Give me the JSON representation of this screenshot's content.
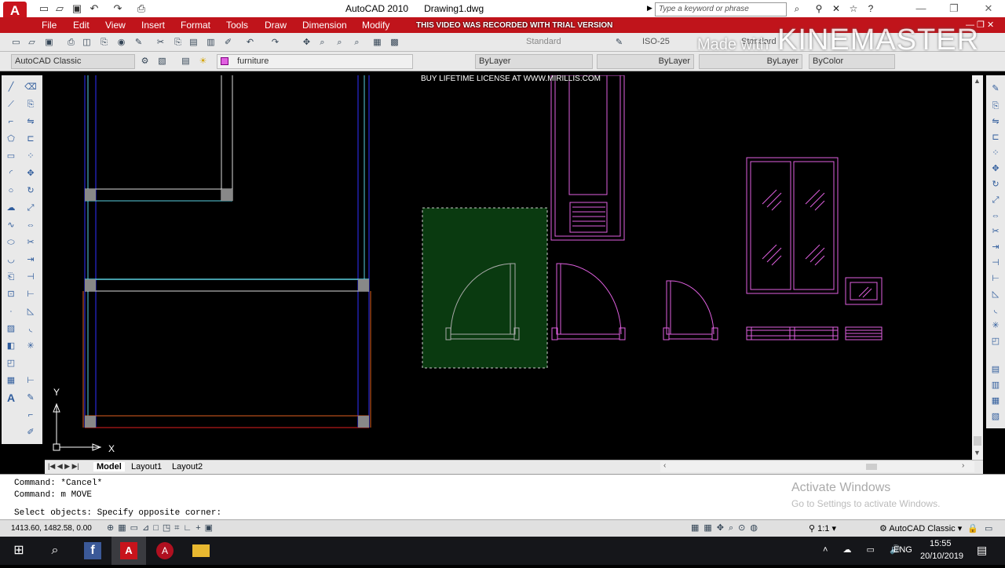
{
  "app": {
    "title": "AutoCAD 2010",
    "document": "Drawing1.dwg",
    "search_placeholder": "Type a keyword or phrase"
  },
  "menu": [
    "File",
    "Edit",
    "View",
    "Insert",
    "Format",
    "Tools",
    "Draw",
    "Dimension",
    "Modify"
  ],
  "toolbar2": {
    "workspace": "AutoCAD Classic",
    "layer": "furniture",
    "color": "ByLayer",
    "linetype": "ByLayer",
    "lineweight": "ByLayer",
    "plotstyle": "ByColor",
    "dimstyle": "ISO-25",
    "textstyle": "Standard",
    "tablestyle": "Standard"
  },
  "watermarks": {
    "trial": "THIS VIDEO WAS RECORDED WITH TRIAL VERSION",
    "license": "BUY LIFETIME LICENSE AT WWW.MIRILLIS.COM",
    "made_with": "Made with",
    "kinemaster": "KINEMASTER",
    "activate": "Activate Windows",
    "activate_sub": "Go to Settings to activate Windows."
  },
  "ucs": {
    "x": "X",
    "y": "Y"
  },
  "tabs": [
    "Model",
    "Layout1",
    "Layout2"
  ],
  "command": {
    "lines": [
      "Command: *Cancel*",
      "Command: m MOVE"
    ],
    "prompt": "Select objects: Specify opposite corner:"
  },
  "status": {
    "coords": "1413.60, 1482.58, 0.00",
    "scale": "1:1",
    "workspace": "AutoCAD Classic"
  },
  "taskbar": {
    "lang": "ENG",
    "time": "15:55",
    "date": "20/10/2019"
  },
  "colors": {
    "menubar": "#c0141b",
    "selection": "#0a3a10",
    "furniture": "#e060e0"
  }
}
